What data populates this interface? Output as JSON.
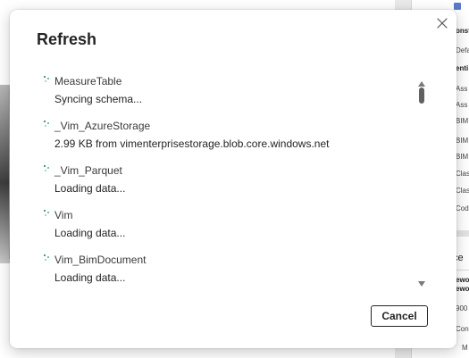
{
  "dialog": {
    "title": "Refresh",
    "cancel_label": "Cancel",
    "items": [
      {
        "name": "MeasureTable",
        "status": "Syncing schema..."
      },
      {
        "name": "_Vim_AzureStorage",
        "status": "2.99 KB from vimenterprisestorage.blob.core.windows.net"
      },
      {
        "name": "_Vim_Parquet",
        "status": "Loading data..."
      },
      {
        "name": "Vim",
        "status": "Loading data..."
      },
      {
        "name": "Vim_BimDocument",
        "status": "Loading data..."
      }
    ],
    "icons": {
      "close": "close-icon",
      "item_status": "spinner-icon",
      "scroll_up": "chevron-up-icon",
      "scroll_down": "chevron-down-icon"
    }
  },
  "background": {
    "right_panel": {
      "rows": [
        "onst",
        "Defa",
        "enti",
        "Ass",
        "Ass",
        "BIM",
        "BIM",
        "BIM",
        "Clas",
        "Clas",
        "Cod"
      ],
      "section_label": "ce",
      "lower_rows": [
        "ewo",
        "ewo",
        "900",
        "Con",
        "M"
      ]
    }
  },
  "colors": {
    "accent": "#0e7a72",
    "dialog_bg": "#ffffff",
    "text_primary": "#252423",
    "canvas_edge": "#3ed2d2"
  }
}
